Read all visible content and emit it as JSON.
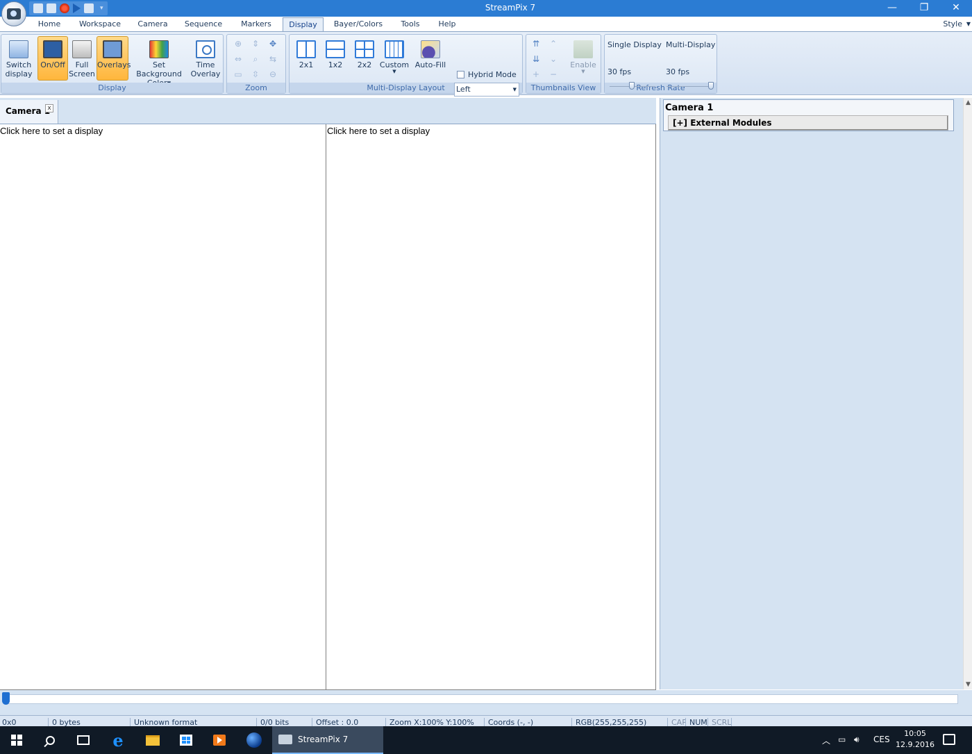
{
  "window": {
    "title": "StreamPix 7",
    "minimize": "—",
    "restore": "❐",
    "close": "✕"
  },
  "ribbon_tabs": [
    "Home",
    "Workspace",
    "Camera",
    "Sequence",
    "Markers",
    "Display",
    "Bayer/Colors",
    "Tools",
    "Help"
  ],
  "active_tab": "Display",
  "style_menu": "Style",
  "groups": {
    "display": {
      "label": "Display",
      "switch_display": "Switch display",
      "on_off": "On/Off",
      "full_screen": "Full Screen",
      "overlays": "Overlays",
      "set_background": "Set Background",
      "set_background_2": "Color",
      "time_overlay": "Time Overlay"
    },
    "zoom": {
      "label": "Zoom"
    },
    "multi": {
      "label": "Multi-Display Layout",
      "l2x1": "2x1",
      "l1x2": "1x2",
      "l2x2": "2x2",
      "custom": "Custom",
      "autofill": "Auto-Fill",
      "hybrid_mode": "Hybrid Mode",
      "position_value": "Left"
    },
    "thumbnails": {
      "label": "Thumbnails View",
      "enable": "Enable"
    },
    "refresh": {
      "label": "Refresh Rate",
      "single": "Single Display",
      "multi": "Multi-Display",
      "single_fps": "30 fps",
      "multi_fps": "30 fps"
    }
  },
  "doc_tab": {
    "label": "Camera 1",
    "close": "x"
  },
  "panes": [
    {
      "text": "Click here to set a display"
    },
    {
      "text": "Click here to set a display"
    }
  ],
  "right_panel": {
    "title": "Camera 1",
    "modules": "[+] External Modules"
  },
  "status": {
    "resolution": "0x0",
    "size": "0 bytes",
    "format": "Unknown format",
    "bits": "0/0 bits",
    "offset": "Offset : 0.0",
    "zoom": "Zoom X:100%  Y:100%",
    "coords": "Coords (-, -)",
    "rgb": "RGB(255,255,255)",
    "cap": "CAP",
    "num": "NUM",
    "scrl": "SCRL"
  },
  "taskbar": {
    "app_label": "StreamPix 7",
    "language": "CES",
    "time": "10:05",
    "date": "12.9.2016"
  }
}
